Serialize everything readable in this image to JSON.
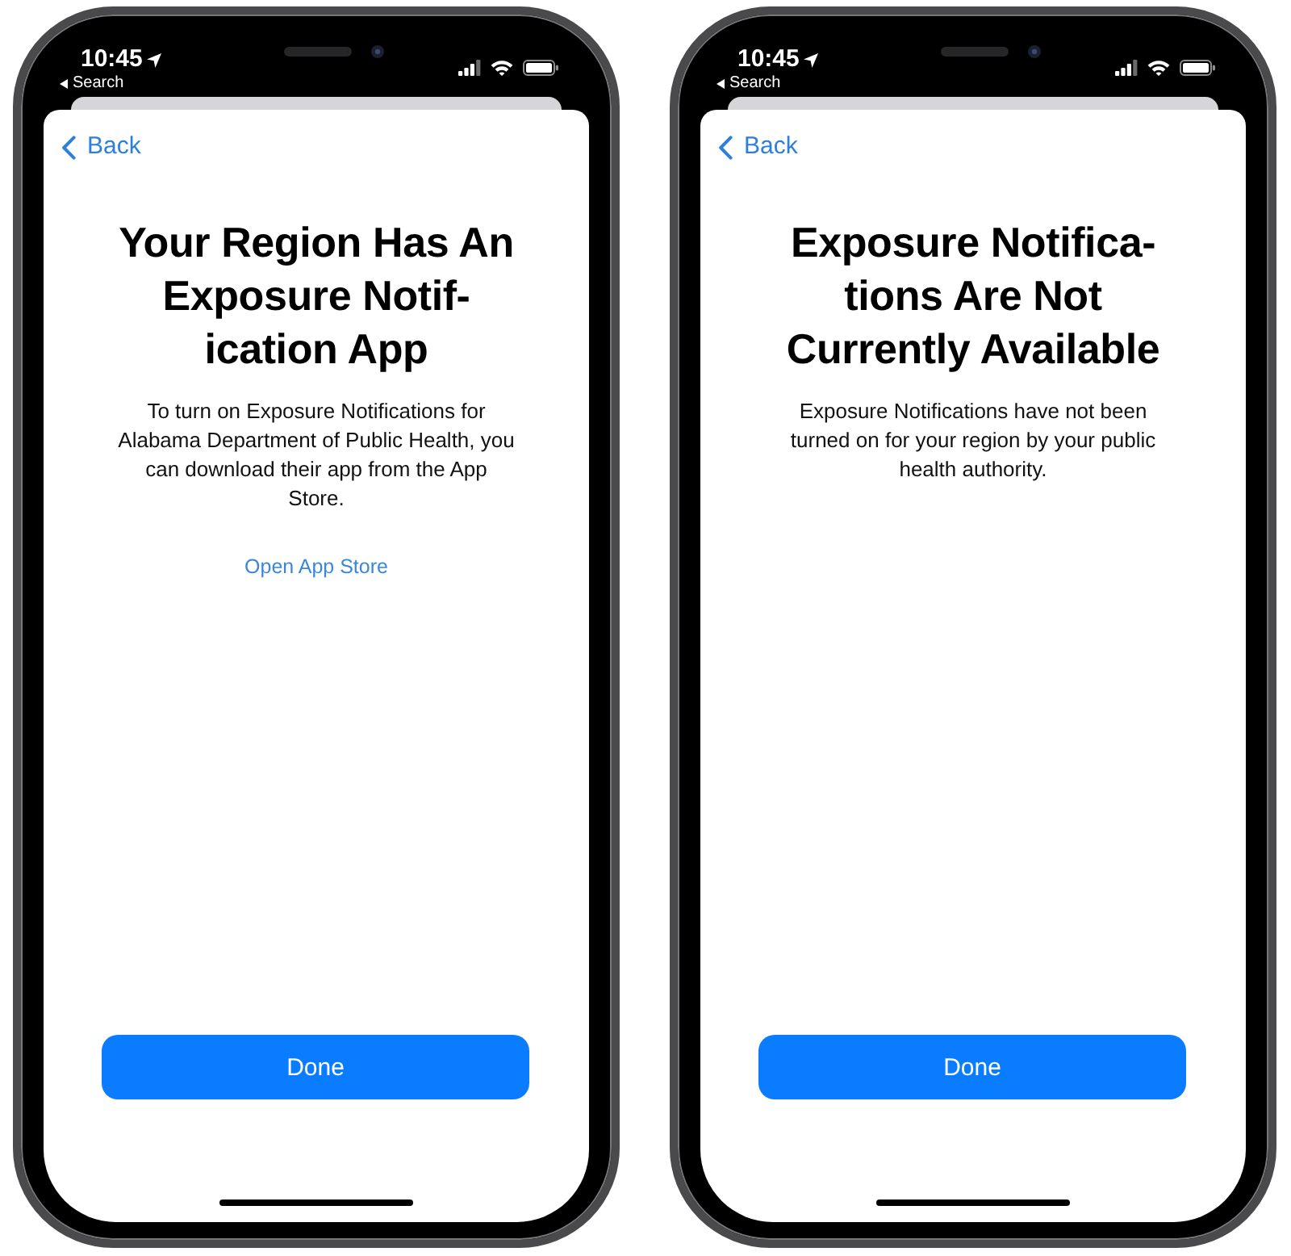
{
  "phones": [
    {
      "status_bar": {
        "time": "10:45",
        "return_app": "Search"
      },
      "back": "Back",
      "title": "Your Region Has An\nExposure Notif-\nication App",
      "body": "To turn on Exposure Notifications for\nAlabama Department of Public Health, you\ncan download their app from the App\nStore.",
      "link": "Open App Store",
      "button": "Done"
    },
    {
      "status_bar": {
        "time": "10:45",
        "return_app": "Search"
      },
      "back": "Back",
      "title": "Exposure Notifica-\ntions Are Not\nCurrently Available",
      "body": "Exposure Notifications have not been\nturned on for your region by your public\nhealth authority.",
      "button": "Done"
    }
  ]
}
